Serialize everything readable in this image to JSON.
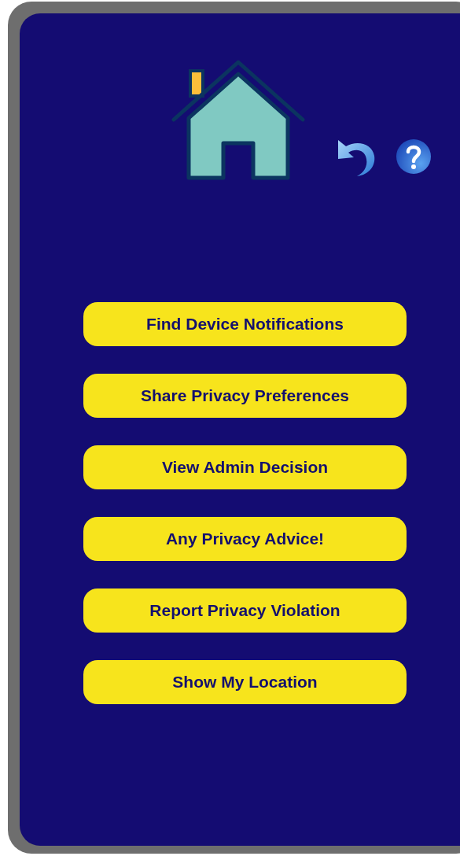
{
  "menu_buttons": [
    "Find Device Notifications",
    "Share Privacy Preferences",
    "View Admin Decision",
    "Any Privacy Advice!",
    "Report Privacy Violation",
    "Show My Location"
  ]
}
